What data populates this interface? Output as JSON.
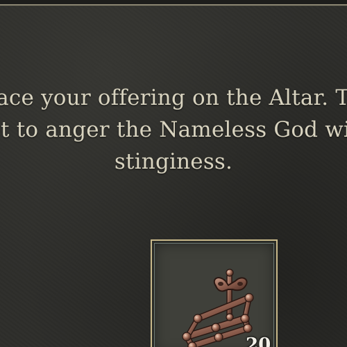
{
  "message": {
    "lines": [
      "Place your offering on the Altar. Try",
      "not to anger the Nameless God with",
      "stinginess."
    ]
  },
  "offering_slot": {
    "item_icon": "iron-stocks-icon",
    "count": "20"
  },
  "colors": {
    "text": "#d8d3bf",
    "slot_border": "#c9b98a",
    "background": "#2e2e2b"
  }
}
